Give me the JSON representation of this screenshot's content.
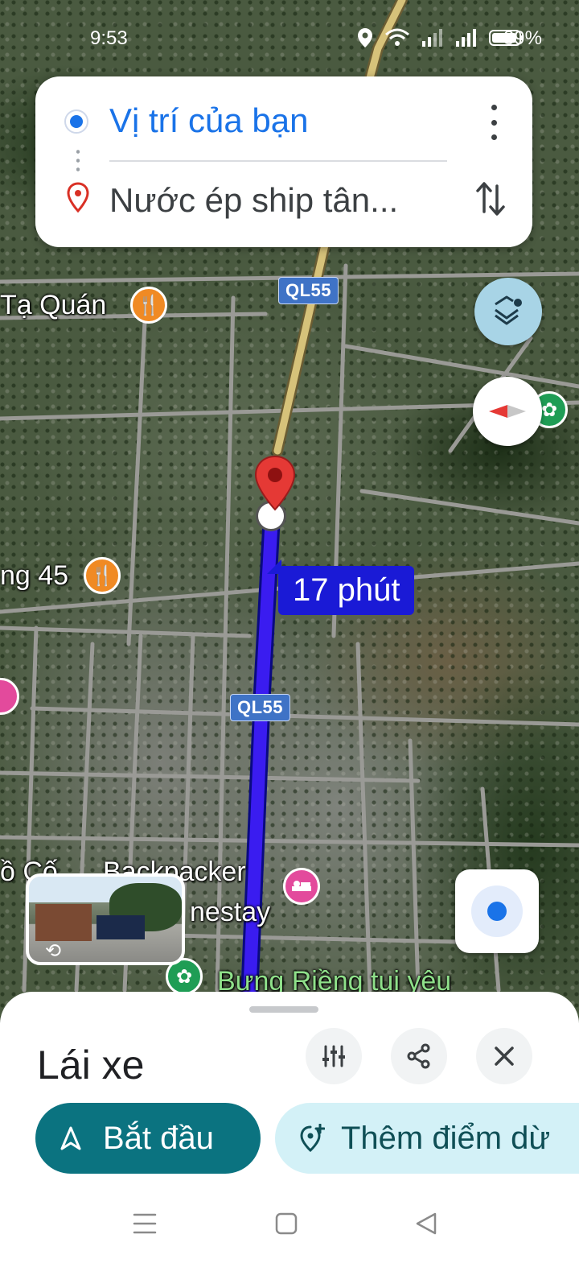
{
  "status_bar": {
    "time": "9:53",
    "battery_percent": "89%",
    "icons": [
      "location-icon",
      "wifi-icon",
      "signal-icon",
      "signal-icon",
      "battery-icon"
    ]
  },
  "route": {
    "origin": "Vị trí của bạn",
    "destination": "Nước ép ship tân..."
  },
  "map": {
    "road_shields": [
      "QL55",
      "QL55"
    ],
    "eta_label": "17 phút",
    "pois": [
      {
        "label": "Tạ Quán",
        "icon": "restaurant-icon"
      },
      {
        "label": "ng 45",
        "icon": "restaurant-icon"
      },
      {
        "label": "ồ Cố",
        "icon": "hotel-icon"
      },
      {
        "label": "Backpacker",
        "icon": "hotel-icon"
      },
      {
        "label": "nestay",
        "icon": "hotel-icon"
      },
      {
        "label": "Bưng Riềng tui yêu",
        "icon": "park-icon"
      }
    ],
    "colors": {
      "route": "#1a1ad6",
      "highway": "#d6c27a",
      "accent": "#1a73e8"
    }
  },
  "sheet": {
    "mode_title": "Lái xe",
    "start_label": "Bắt đầu",
    "add_stop_label": "Thêm điểm dừ"
  }
}
